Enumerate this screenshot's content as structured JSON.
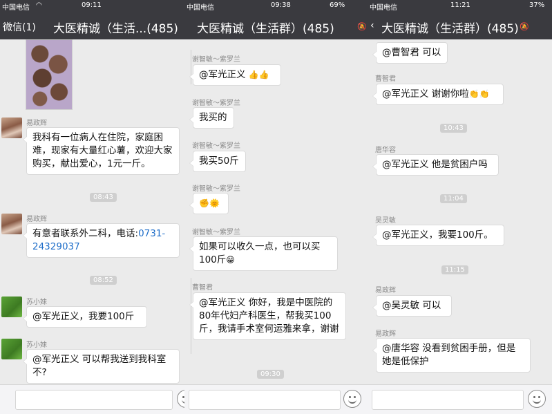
{
  "panels": [
    {
      "status": {
        "carrier": "中国电信",
        "time": "09:11"
      },
      "nav": {
        "back": "微信(1)",
        "title": "大医精诚（生活...(485)"
      },
      "messages": [
        {
          "sender": "易政辉",
          "text": "我科有一位病人在住院，家庭困难，现家有大量红心薯，欢迎大家购买，献出爱心，1元一斤。"
        },
        {
          "time": "08:43"
        },
        {
          "sender": "易政辉",
          "text_prefix": "有意者联系外二科，电话:",
          "phone": "0731-24329037"
        },
        {
          "time": "08:52"
        },
        {
          "sender": "苏小妹",
          "text": "@军光正义，我要100斤"
        },
        {
          "sender": "苏小妹",
          "text": "@军光正义 可以帮我送到我科室不?"
        }
      ]
    },
    {
      "status": {
        "carrier": "中国电信",
        "time": "09:38",
        "battery": "69%"
      },
      "nav": {
        "title": "大医精诚（生活群）(485)"
      },
      "messages": [
        {
          "sender": "谢智敏～紫罗兰",
          "text": "@军光正义",
          "emoji": "👍👍"
        },
        {
          "sender": "谢智敏～紫罗兰",
          "text": "我买的"
        },
        {
          "sender": "谢智敏～紫罗兰",
          "text": "我买50斤"
        },
        {
          "sender": "谢智敏～紫罗兰",
          "emoji": "✊🌞"
        },
        {
          "sender": "谢智敏～紫罗兰",
          "text": "如果可以收久一点，也可以买100斤",
          "emoji": "😁"
        },
        {
          "sender": "曹智君",
          "text": "@军光正义 你好，我是中医院的80年代妇产科医生，帮我买100斤，我请手术室何运雅来拿，谢谢"
        },
        {
          "time": "09:30"
        }
      ]
    },
    {
      "status": {
        "carrier": "中国电信",
        "time": "11:21",
        "battery": "37%"
      },
      "nav": {
        "title": "大医精诚（生活群）(485)"
      },
      "messages": [
        {
          "text": "@曹智君 可以"
        },
        {
          "sender": "曹智君",
          "text": "@军光正义 谢谢你啦",
          "emoji": "👏👏"
        },
        {
          "time": "10:43"
        },
        {
          "sender": "唐华容",
          "text": "@军光正义 他是贫困户吗"
        },
        {
          "time": "11:04"
        },
        {
          "sender": "吴灵敏",
          "text": "@军光正义，我要100斤。"
        },
        {
          "time": "11:15"
        },
        {
          "sender": "易政辉",
          "text": "@吴灵敏 可以"
        },
        {
          "sender": "易政辉",
          "text": "@唐华容 没看到贫困手册，但是她是低保护"
        }
      ]
    }
  ],
  "icons": [
    "wifi-icon",
    "lock-icon",
    "bluetooth-icon",
    "mute-icon",
    "emoji-icon",
    "back-chevron-icon"
  ]
}
